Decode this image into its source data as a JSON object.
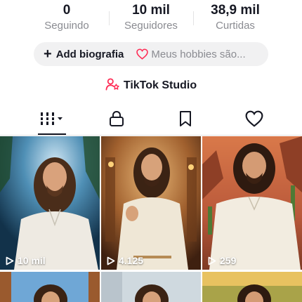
{
  "stats": [
    {
      "value": "0",
      "label": "Seguindo"
    },
    {
      "value": "10 mil",
      "label": "Seguidores"
    },
    {
      "value": "38,9 mil",
      "label": "Curtidas"
    }
  ],
  "bio": {
    "add_label": "Add biografia",
    "hobbies_placeholder": "Meus hobbies são..."
  },
  "studio": {
    "label": "TikTok Studio"
  },
  "tabs": [
    {
      "icon": "grid-icon",
      "active": true
    },
    {
      "icon": "lock-icon",
      "active": false
    },
    {
      "icon": "bookmark-icon",
      "active": false
    },
    {
      "icon": "heart-icon",
      "active": false
    }
  ],
  "videos": [
    {
      "views": "10 mil"
    },
    {
      "views": "4.125"
    },
    {
      "views": "259"
    },
    {
      "views": ""
    },
    {
      "views": ""
    },
    {
      "views": ""
    }
  ],
  "colors": {
    "accent_pink": "#fe2c55",
    "text": "#161823",
    "muted": "#8a8b91",
    "pill": "#f1f1f2"
  }
}
